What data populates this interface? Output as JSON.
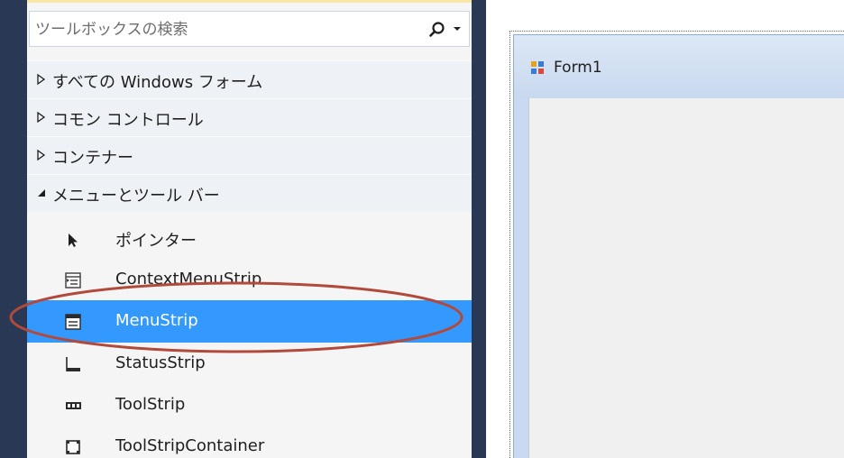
{
  "toolbox": {
    "search_placeholder": "ツールボックスの検索",
    "categories": [
      {
        "label": "すべての Windows フォーム",
        "expanded": false
      },
      {
        "label": "コモン コントロール",
        "expanded": false
      },
      {
        "label": "コンテナー",
        "expanded": false
      },
      {
        "label": "メニューとツール バー",
        "expanded": true
      }
    ],
    "items": [
      {
        "label": "ポインター",
        "icon": "pointer-icon",
        "selected": false
      },
      {
        "label": "ContextMenuStrip",
        "icon": "context-menu-strip-icon",
        "selected": false
      },
      {
        "label": "MenuStrip",
        "icon": "menu-strip-icon",
        "selected": true
      },
      {
        "label": "StatusStrip",
        "icon": "status-strip-icon",
        "selected": false
      },
      {
        "label": "ToolStrip",
        "icon": "tool-strip-icon",
        "selected": false
      },
      {
        "label": "ToolStripContainer",
        "icon": "tool-strip-container-icon",
        "selected": false
      }
    ]
  },
  "designer": {
    "form_title": "Form1"
  },
  "colors": {
    "selection": "#3399ff",
    "frame": "#293955",
    "annotation": "#b24a3c"
  }
}
